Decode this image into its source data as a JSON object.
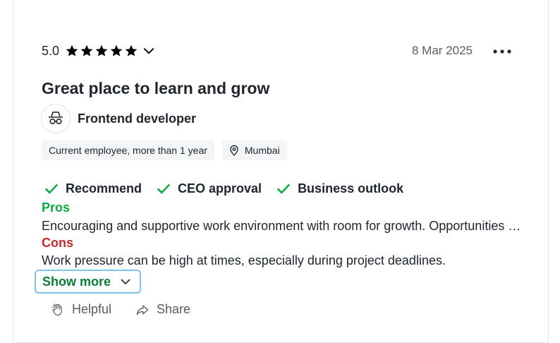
{
  "review": {
    "rating": "5.0",
    "star_count": 5,
    "date": "8 Mar 2025",
    "title": "Great place to learn and grow",
    "role": "Frontend developer",
    "tags": {
      "employment": "Current employee, more than 1 year",
      "location": "Mumbai"
    },
    "ratings": {
      "recommend": "Recommend",
      "ceo": "CEO approval",
      "outlook": "Business outlook"
    },
    "pros_label": "Pros",
    "pros_text": "Encouraging and supportive work environment with room for growth. Opportunities to work on diverse projects and learn new technologies.",
    "cons_label": "Cons",
    "cons_text": "Work pressure can be high at times, especially during project deadlines.",
    "show_more": "Show more",
    "helpful": "Helpful",
    "share": "Share"
  },
  "colors": {
    "star": "#000000",
    "pros": "#0caa41",
    "cons": "#c42a2a",
    "check": "#0caa41",
    "show_more_text": "#0a7d36",
    "show_more_border": "#7ec3ea"
  },
  "icons": {
    "star": "star-icon",
    "chevron": "chevron-down-icon",
    "more": "more-horizontal-icon",
    "avatar": "incognito-icon",
    "location": "map-pin-icon",
    "check": "check-icon",
    "helpful": "clap-icon",
    "share": "share-icon"
  }
}
